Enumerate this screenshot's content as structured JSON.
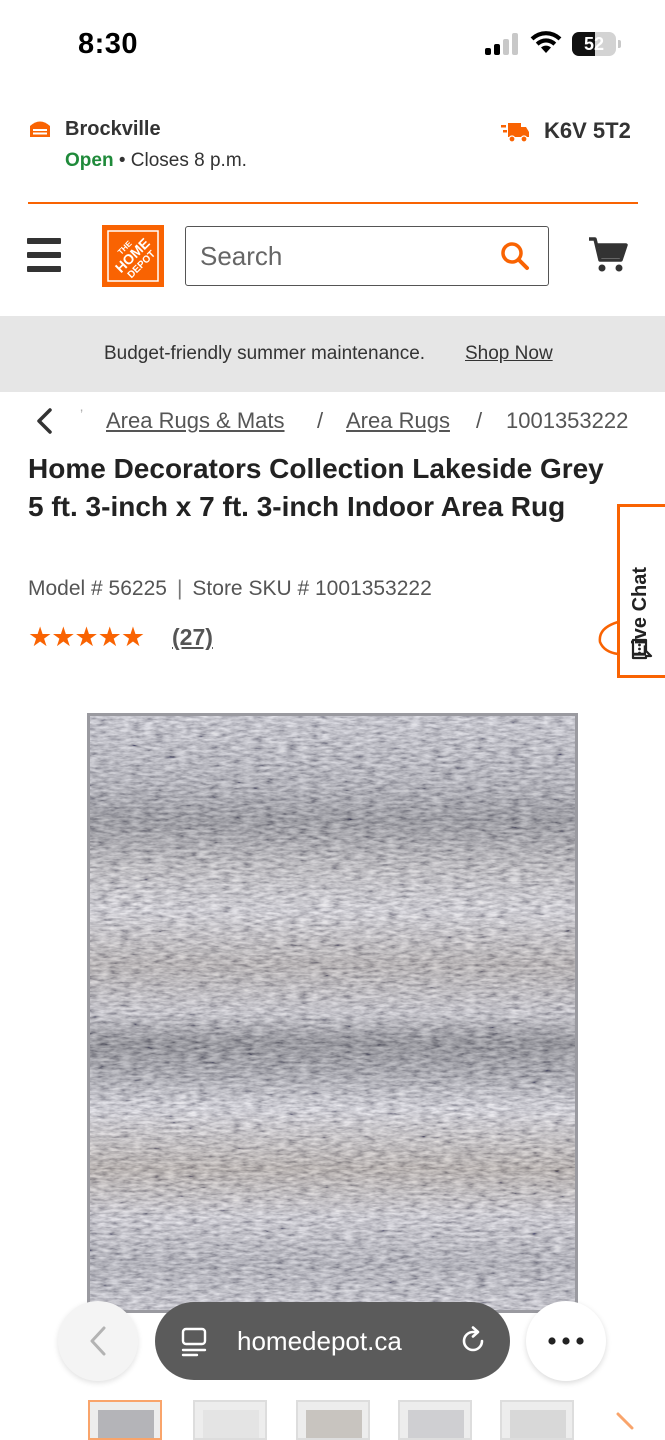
{
  "status_bar": {
    "time": "8:30",
    "battery_level": "52",
    "battery_fraction": 0.52
  },
  "store": {
    "name": "Brockville",
    "open_label": "Open",
    "hours_text": " • Closes 8 p.m.",
    "postal_code": "K6V 5T2"
  },
  "header": {
    "search_placeholder": "Search",
    "logo_text": "THE HOME DEPOT"
  },
  "promo": {
    "text": "Budget-friendly summer maintenance.",
    "link": "Shop Now"
  },
  "breadcrumb": {
    "items": [
      "Area Rugs & Mats",
      "Area Rugs"
    ],
    "separator": "/",
    "current": "1001353222"
  },
  "product": {
    "brand": "Home Decorators Collection",
    "name": " Lakeside Grey 5 ft. 3-inch x 7 ft. 3-inch Indoor Area Rug",
    "model_label": "Model # 56225",
    "sku_label": "Store SKU # 1001353222",
    "rating_stars": 5,
    "stars_text": "★★★★★",
    "review_count": "(27)"
  },
  "live_chat": {
    "label": "Live Chat"
  },
  "browser": {
    "url": "homedepot.ca"
  },
  "colors": {
    "brand_orange": "#f96302",
    "open_green": "#1f8a3a",
    "promo_bg": "#e6e6e6"
  },
  "icons": {
    "store": "store-icon",
    "truck": "delivery-truck-icon",
    "menu": "hamburger-menu-icon",
    "search": "search-icon",
    "cart": "cart-icon",
    "back": "chevron-left-icon",
    "chat": "chat-bubble-icon",
    "reader": "reader-mode-icon",
    "reload": "reload-icon",
    "more": "more-dots-icon"
  }
}
